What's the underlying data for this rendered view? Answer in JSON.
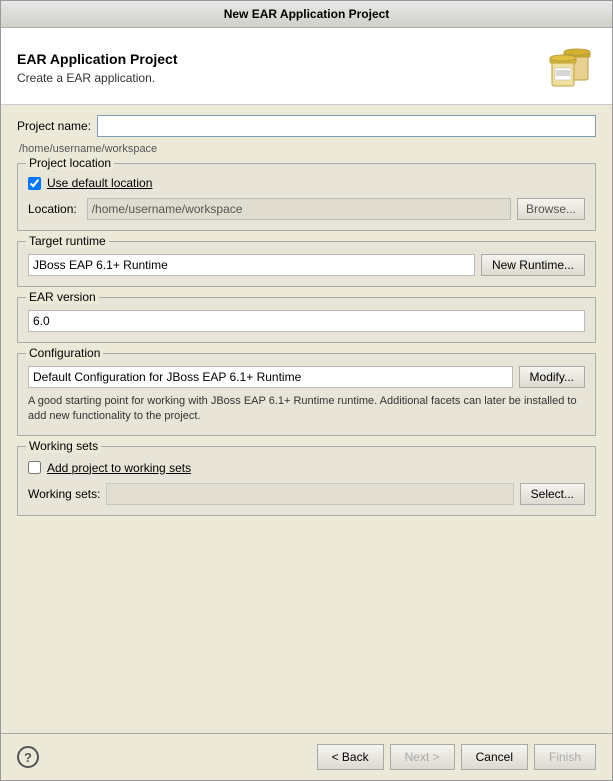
{
  "window": {
    "title": "New EAR Application Project"
  },
  "header": {
    "title": "EAR Application Project",
    "subtitle": "Create a EAR application."
  },
  "form": {
    "project_name_label": "Project name:",
    "project_name_value": "",
    "path_hint": "/home/username/workspace",
    "project_location_group": "Project location",
    "use_default_location_label": "Use default location",
    "use_default_location_checked": true,
    "location_label": "Location:",
    "location_value": "/home/username/workspace",
    "browse_label": "Browse...",
    "target_runtime_group": "Target runtime",
    "runtime_option": "JBoss EAP 6.1+ Runtime",
    "new_runtime_label": "New Runtime...",
    "ear_version_group": "EAR version",
    "ear_version_option": "6.0",
    "configuration_group": "Configuration",
    "configuration_option": "Default Configuration for JBoss EAP 6.1+ Runtime",
    "modify_label": "Modify...",
    "configuration_desc": "A good starting point for working with JBoss EAP 6.1+ Runtime runtime. Additional facets can later be installed to add new functionality to the project.",
    "working_sets_group": "Working sets",
    "add_to_working_sets_label": "Add project to working sets",
    "add_to_working_sets_checked": false,
    "working_sets_label": "Working sets:",
    "select_label": "Select..."
  },
  "buttons": {
    "help_label": "?",
    "back_label": "< Back",
    "next_label": "Next >",
    "cancel_label": "Cancel",
    "finish_label": "Finish"
  }
}
